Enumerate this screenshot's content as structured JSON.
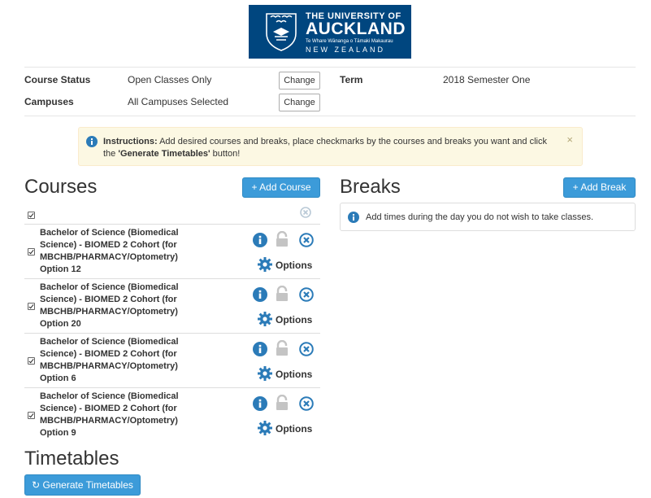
{
  "logo": {
    "line1": "THE UNIVERSITY OF",
    "line2": "AUCKLAND",
    "line3": "Te Whare Wānanga o Tāmaki Makaurau",
    "line4": "NEW ZEALAND"
  },
  "filters": {
    "course_status_label": "Course Status",
    "course_status_value": "Open Classes Only",
    "campuses_label": "Campuses",
    "campuses_value": "All Campuses Selected",
    "change_label": "Change",
    "term_label": "Term",
    "term_value": "2018 Semester One"
  },
  "instructions": {
    "bold": "Instructions:",
    "text1": " Add desired courses and breaks, place checkmarks by the courses and breaks you want and click the ",
    "bold2": "'Generate Timetables'",
    "text2": " button!",
    "close": "×"
  },
  "courses": {
    "title": "Courses",
    "add_button": "Add Course",
    "options_label": "Options",
    "items": [
      {
        "line1": "Bachelor of Science (Biomedical",
        "line2": "Science) - BIOMED 2 Cohort (for",
        "line3": "MBCHB/PHARMACY/Optometry)",
        "line4": "Option 12",
        "checked": true
      },
      {
        "line1": "Bachelor of Science (Biomedical",
        "line2": "Science) - BIOMED 2 Cohort (for",
        "line3": "MBCHB/PHARMACY/Optometry)",
        "line4": "Option 20",
        "checked": true
      },
      {
        "line1": "Bachelor of Science (Biomedical",
        "line2": "Science) - BIOMED 2 Cohort (for",
        "line3": "MBCHB/PHARMACY/Optometry)",
        "line4": "Option 6",
        "checked": true
      },
      {
        "line1": "Bachelor of Science (Biomedical",
        "line2": "Science) - BIOMED 2 Cohort (for",
        "line3": "MBCHB/PHARMACY/Optometry)",
        "line4": "Option 9",
        "checked": true
      }
    ]
  },
  "breaks": {
    "title": "Breaks",
    "add_button": "Add Break",
    "info_text": "Add times during the day you do not wish to take classes."
  },
  "timetables": {
    "title": "Timetables",
    "generate_button": "Generate Timetables"
  },
  "colors": {
    "primary": "#3c9bd9",
    "info_icon": "#2b7bb8",
    "logo_bg": "#00467f",
    "warning_bg": "#fcf8e3"
  }
}
